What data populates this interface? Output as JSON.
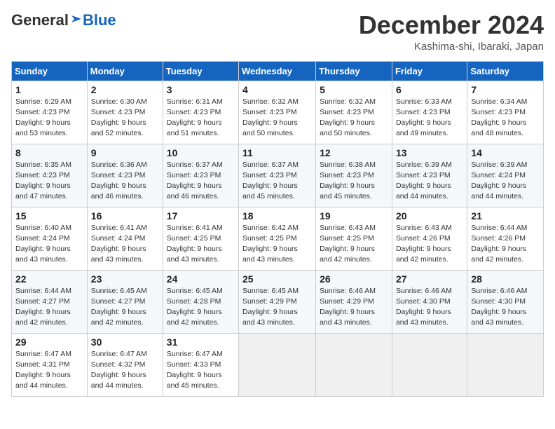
{
  "header": {
    "logo": {
      "general": "General",
      "blue": "Blue"
    },
    "title": "December 2024",
    "location": "Kashima-shi, Ibaraki, Japan"
  },
  "calendar": {
    "weekdays": [
      "Sunday",
      "Monday",
      "Tuesday",
      "Wednesday",
      "Thursday",
      "Friday",
      "Saturday"
    ],
    "weeks": [
      [
        {
          "day": "1",
          "detail": "Sunrise: 6:29 AM\nSunset: 4:23 PM\nDaylight: 9 hours\nand 53 minutes."
        },
        {
          "day": "2",
          "detail": "Sunrise: 6:30 AM\nSunset: 4:23 PM\nDaylight: 9 hours\nand 52 minutes."
        },
        {
          "day": "3",
          "detail": "Sunrise: 6:31 AM\nSunset: 4:23 PM\nDaylight: 9 hours\nand 51 minutes."
        },
        {
          "day": "4",
          "detail": "Sunrise: 6:32 AM\nSunset: 4:23 PM\nDaylight: 9 hours\nand 50 minutes."
        },
        {
          "day": "5",
          "detail": "Sunrise: 6:32 AM\nSunset: 4:23 PM\nDaylight: 9 hours\nand 50 minutes."
        },
        {
          "day": "6",
          "detail": "Sunrise: 6:33 AM\nSunset: 4:23 PM\nDaylight: 9 hours\nand 49 minutes."
        },
        {
          "day": "7",
          "detail": "Sunrise: 6:34 AM\nSunset: 4:23 PM\nDaylight: 9 hours\nand 48 minutes."
        }
      ],
      [
        {
          "day": "8",
          "detail": "Sunrise: 6:35 AM\nSunset: 4:23 PM\nDaylight: 9 hours\nand 47 minutes."
        },
        {
          "day": "9",
          "detail": "Sunrise: 6:36 AM\nSunset: 4:23 PM\nDaylight: 9 hours\nand 46 minutes."
        },
        {
          "day": "10",
          "detail": "Sunrise: 6:37 AM\nSunset: 4:23 PM\nDaylight: 9 hours\nand 46 minutes."
        },
        {
          "day": "11",
          "detail": "Sunrise: 6:37 AM\nSunset: 4:23 PM\nDaylight: 9 hours\nand 45 minutes."
        },
        {
          "day": "12",
          "detail": "Sunrise: 6:38 AM\nSunset: 4:23 PM\nDaylight: 9 hours\nand 45 minutes."
        },
        {
          "day": "13",
          "detail": "Sunrise: 6:39 AM\nSunset: 4:23 PM\nDaylight: 9 hours\nand 44 minutes."
        },
        {
          "day": "14",
          "detail": "Sunrise: 6:39 AM\nSunset: 4:24 PM\nDaylight: 9 hours\nand 44 minutes."
        }
      ],
      [
        {
          "day": "15",
          "detail": "Sunrise: 6:40 AM\nSunset: 4:24 PM\nDaylight: 9 hours\nand 43 minutes."
        },
        {
          "day": "16",
          "detail": "Sunrise: 6:41 AM\nSunset: 4:24 PM\nDaylight: 9 hours\nand 43 minutes."
        },
        {
          "day": "17",
          "detail": "Sunrise: 6:41 AM\nSunset: 4:25 PM\nDaylight: 9 hours\nand 43 minutes."
        },
        {
          "day": "18",
          "detail": "Sunrise: 6:42 AM\nSunset: 4:25 PM\nDaylight: 9 hours\nand 43 minutes."
        },
        {
          "day": "19",
          "detail": "Sunrise: 6:43 AM\nSunset: 4:25 PM\nDaylight: 9 hours\nand 42 minutes."
        },
        {
          "day": "20",
          "detail": "Sunrise: 6:43 AM\nSunset: 4:26 PM\nDaylight: 9 hours\nand 42 minutes."
        },
        {
          "day": "21",
          "detail": "Sunrise: 6:44 AM\nSunset: 4:26 PM\nDaylight: 9 hours\nand 42 minutes."
        }
      ],
      [
        {
          "day": "22",
          "detail": "Sunrise: 6:44 AM\nSunset: 4:27 PM\nDaylight: 9 hours\nand 42 minutes."
        },
        {
          "day": "23",
          "detail": "Sunrise: 6:45 AM\nSunset: 4:27 PM\nDaylight: 9 hours\nand 42 minutes."
        },
        {
          "day": "24",
          "detail": "Sunrise: 6:45 AM\nSunset: 4:28 PM\nDaylight: 9 hours\nand 42 minutes."
        },
        {
          "day": "25",
          "detail": "Sunrise: 6:45 AM\nSunset: 4:29 PM\nDaylight: 9 hours\nand 43 minutes."
        },
        {
          "day": "26",
          "detail": "Sunrise: 6:46 AM\nSunset: 4:29 PM\nDaylight: 9 hours\nand 43 minutes."
        },
        {
          "day": "27",
          "detail": "Sunrise: 6:46 AM\nSunset: 4:30 PM\nDaylight: 9 hours\nand 43 minutes."
        },
        {
          "day": "28",
          "detail": "Sunrise: 6:46 AM\nSunset: 4:30 PM\nDaylight: 9 hours\nand 43 minutes."
        }
      ],
      [
        {
          "day": "29",
          "detail": "Sunrise: 6:47 AM\nSunset: 4:31 PM\nDaylight: 9 hours\nand 44 minutes."
        },
        {
          "day": "30",
          "detail": "Sunrise: 6:47 AM\nSunset: 4:32 PM\nDaylight: 9 hours\nand 44 minutes."
        },
        {
          "day": "31",
          "detail": "Sunrise: 6:47 AM\nSunset: 4:33 PM\nDaylight: 9 hours\nand 45 minutes."
        },
        {
          "day": "",
          "detail": ""
        },
        {
          "day": "",
          "detail": ""
        },
        {
          "day": "",
          "detail": ""
        },
        {
          "day": "",
          "detail": ""
        }
      ]
    ]
  }
}
